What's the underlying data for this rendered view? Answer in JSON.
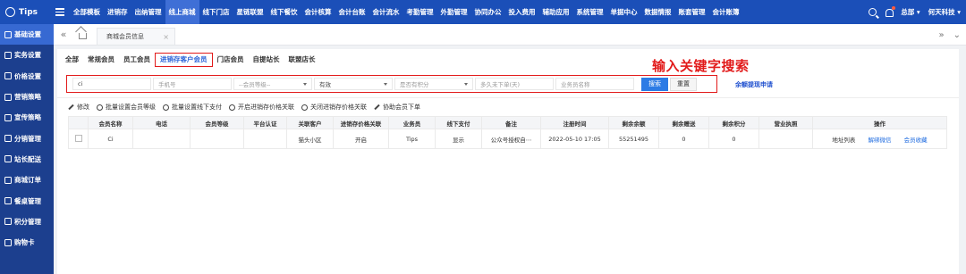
{
  "topnav": {
    "brand": "Tips",
    "items": [
      "全部模板",
      "进销存",
      "出纳管理",
      "线上商城",
      "线下门店",
      "星链联盟",
      "线下餐饮",
      "会计核算",
      "会计台账",
      "会计流水",
      "考勤管理",
      "外勤管理",
      "协同办公",
      "投入费用",
      "辅助应用",
      "系统管理",
      "单据中心",
      "数据情报",
      "账套管理",
      "会计账簿"
    ],
    "active_index": 3,
    "right_items": [
      "总部",
      "何天科技"
    ]
  },
  "sidebar": {
    "items": [
      "基础设置",
      "实务设置",
      "价格设置",
      "营销策略",
      "宣传策略",
      "分销管理",
      "站长配送",
      "商城订单",
      "餐桌管理",
      "积分管理",
      "购物卡"
    ],
    "active_index": 0
  },
  "tabbar": {
    "page_tab": "商城会员信息",
    "close": "×",
    "back": "«",
    "forward": "»",
    "more": "⌄"
  },
  "member_tabs": {
    "items": [
      "全部",
      "常规会员",
      "员工会员",
      "进销存客户会员",
      "门店会员",
      "自提站长",
      "联盟店长"
    ],
    "active_index": 3
  },
  "annotation": "输入关键字搜索",
  "search": {
    "keyword_value": "ci",
    "phone_placeholder": "手机号",
    "level_placeholder": "--会员等级--",
    "status_value": "有效",
    "points_placeholder": "是否有积分",
    "days_placeholder": "多久未下单(天)",
    "salesman_placeholder": "业务员名称",
    "search_label": "搜索",
    "reset_label": "重置",
    "apply_link": "余额提现申请"
  },
  "toolbar": {
    "items": [
      "修改",
      "批量设置会员等级",
      "批量设置线下支付",
      "开启进销存价格关联",
      "关闭进销存价格关联",
      "协助会员下单"
    ]
  },
  "table": {
    "columns": [
      "",
      "会员名称",
      "电话",
      "会员等级",
      "平台认证",
      "关联客户",
      "进销存价格关联",
      "业务员",
      "线下支付",
      "备注",
      "注册时间",
      "剩余余额",
      "剩余赠送",
      "剩余积分",
      "营业执照",
      "操作"
    ],
    "rows": [
      {
        "name": "Ci",
        "phone": "",
        "level": "",
        "cert": "",
        "customer": "猫头小区",
        "price_link": "开启",
        "salesman": "Tips",
        "offline_pay": "显示",
        "remark": "公众号授权自⋯",
        "reg_time": "2022-05-10 17:05",
        "balance": "55251495",
        "gift": "0",
        "points": "0",
        "license": "",
        "ops": [
          "地址列表",
          "解绑微信",
          "会员收藏"
        ]
      }
    ]
  }
}
